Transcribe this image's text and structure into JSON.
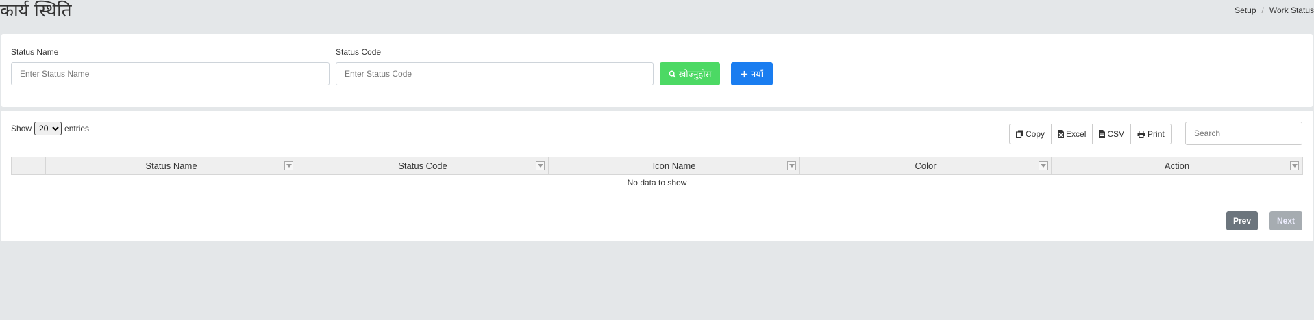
{
  "page": {
    "title": "कार्य स्थिति"
  },
  "breadcrumb": {
    "items": [
      "Setup",
      "Work Status"
    ],
    "separator": "/"
  },
  "filter": {
    "status_name_label": "Status Name",
    "status_name_placeholder": "Enter Status Name",
    "status_code_label": "Status Code",
    "status_code_placeholder": "Enter Status Code",
    "search_button": "खोज्नुहोस",
    "new_button": "नयाँ",
    "colors": {
      "search": "#4cd964",
      "new": "#1a7df0"
    }
  },
  "table": {
    "show_label": "Show",
    "entries_value": "20",
    "entries_label": "entries",
    "export_buttons": {
      "copy": "Copy",
      "excel": "Excel",
      "csv": "CSV",
      "print": "Print"
    },
    "search_placeholder": "Search",
    "columns": [
      "",
      "Status Name",
      "Status Code",
      "Icon Name",
      "Color",
      "Action"
    ],
    "empty_message": "No data to show",
    "pagination": {
      "prev": "Prev",
      "next": "Next"
    }
  }
}
